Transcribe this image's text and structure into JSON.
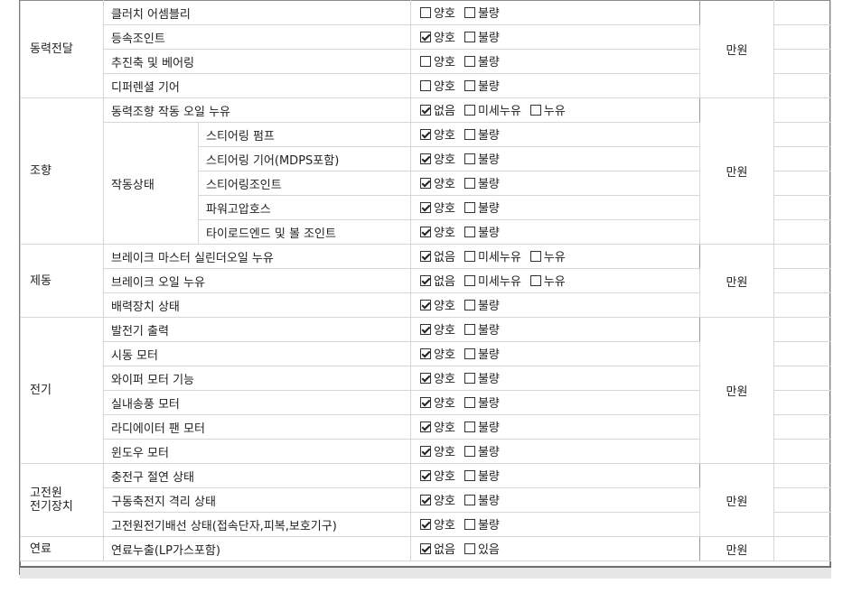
{
  "sections": {
    "drivetrain": {
      "category": "동력전달",
      "price": "만원",
      "items": [
        {
          "label": "클러치 어셈블리",
          "options": [
            {
              "text": "양호",
              "checked": false
            },
            {
              "text": "불량",
              "checked": false
            }
          ]
        },
        {
          "label": "등속조인트",
          "options": [
            {
              "text": "양호",
              "checked": true
            },
            {
              "text": "불량",
              "checked": false
            }
          ]
        },
        {
          "label": "추진축 및 베어링",
          "options": [
            {
              "text": "양호",
              "checked": false
            },
            {
              "text": "불량",
              "checked": false
            }
          ]
        },
        {
          "label": "디퍼렌셜 기어",
          "options": [
            {
              "text": "양호",
              "checked": false
            },
            {
              "text": "불량",
              "checked": false
            }
          ]
        }
      ]
    },
    "steering": {
      "category": "조향",
      "price": "만원",
      "sub_category": "작동상태",
      "items": [
        {
          "label": "동력조향 작동 오일 누유",
          "options": [
            {
              "text": "없음",
              "checked": true
            },
            {
              "text": "미세누유",
              "checked": false
            },
            {
              "text": "누유",
              "checked": false
            }
          ]
        },
        {
          "label": "스티어링 펌프",
          "options": [
            {
              "text": "양호",
              "checked": true
            },
            {
              "text": "불량",
              "checked": false
            }
          ]
        },
        {
          "label": "스티어링 기어(MDPS포함)",
          "options": [
            {
              "text": "양호",
              "checked": true
            },
            {
              "text": "불량",
              "checked": false
            }
          ]
        },
        {
          "label": "스티어링조인트",
          "options": [
            {
              "text": "양호",
              "checked": true
            },
            {
              "text": "불량",
              "checked": false
            }
          ]
        },
        {
          "label": "파워고압호스",
          "options": [
            {
              "text": "양호",
              "checked": true
            },
            {
              "text": "불량",
              "checked": false
            }
          ]
        },
        {
          "label": "타이로드엔드 및 볼 조인트",
          "options": [
            {
              "text": "양호",
              "checked": true
            },
            {
              "text": "불량",
              "checked": false
            }
          ]
        }
      ]
    },
    "brake": {
      "category": "제동",
      "price": "만원",
      "items": [
        {
          "label": "브레이크 마스터 실린더오일 누유",
          "options": [
            {
              "text": "없음",
              "checked": true
            },
            {
              "text": "미세누유",
              "checked": false
            },
            {
              "text": "누유",
              "checked": false
            }
          ]
        },
        {
          "label": "브레이크 오일 누유",
          "options": [
            {
              "text": "없음",
              "checked": true
            },
            {
              "text": "미세누유",
              "checked": false
            },
            {
              "text": "누유",
              "checked": false
            }
          ]
        },
        {
          "label": "배력장치 상태",
          "options": [
            {
              "text": "양호",
              "checked": true
            },
            {
              "text": "불량",
              "checked": false
            }
          ]
        }
      ]
    },
    "electric": {
      "category": "전기",
      "price": "만원",
      "items": [
        {
          "label": "발전기 출력",
          "options": [
            {
              "text": "양호",
              "checked": true
            },
            {
              "text": "불량",
              "checked": false
            }
          ]
        },
        {
          "label": "시동 모터",
          "options": [
            {
              "text": "양호",
              "checked": true
            },
            {
              "text": "불량",
              "checked": false
            }
          ]
        },
        {
          "label": "와이퍼 모터 기능",
          "options": [
            {
              "text": "양호",
              "checked": true
            },
            {
              "text": "불량",
              "checked": false
            }
          ]
        },
        {
          "label": "실내송풍 모터",
          "options": [
            {
              "text": "양호",
              "checked": true
            },
            {
              "text": "불량",
              "checked": false
            }
          ]
        },
        {
          "label": "라디에이터 팬 모터",
          "options": [
            {
              "text": "양호",
              "checked": true
            },
            {
              "text": "불량",
              "checked": false
            }
          ]
        },
        {
          "label": "윈도우 모터",
          "options": [
            {
              "text": "양호",
              "checked": true
            },
            {
              "text": "불량",
              "checked": false
            }
          ]
        }
      ]
    },
    "hv": {
      "category": "고전원\n전기장치",
      "price": "만원",
      "items": [
        {
          "label": "충전구 절연 상태",
          "options": [
            {
              "text": "양호",
              "checked": true
            },
            {
              "text": "불량",
              "checked": false
            }
          ]
        },
        {
          "label": "구동축전지 격리 상태",
          "options": [
            {
              "text": "양호",
              "checked": true
            },
            {
              "text": "불량",
              "checked": false
            }
          ]
        },
        {
          "label": "고전원전기배선 상태(접속단자,피복,보호기구)",
          "options": [
            {
              "text": "양호",
              "checked": true
            },
            {
              "text": "불량",
              "checked": false
            }
          ]
        }
      ]
    },
    "fuel": {
      "category": "연료",
      "price": "만원",
      "items": [
        {
          "label": "연료누출(LP가스포함)",
          "options": [
            {
              "text": "없음",
              "checked": true
            },
            {
              "text": "있음",
              "checked": false
            }
          ]
        }
      ]
    }
  }
}
